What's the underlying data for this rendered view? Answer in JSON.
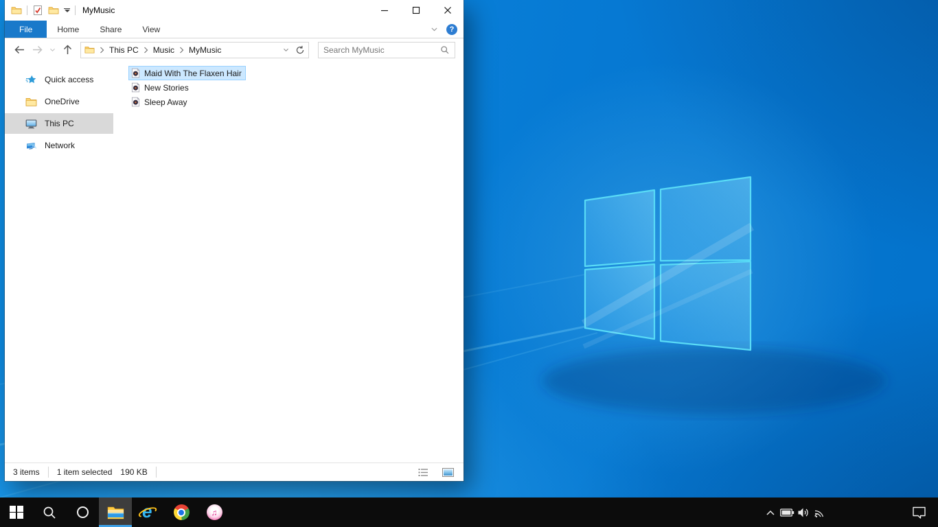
{
  "colors": {
    "accent": "#1979ca",
    "selection_bg": "#cce8ff",
    "selection_border": "#99d1ff",
    "taskbar_bg": "#0c0c0c",
    "active_underline": "#3da1e8"
  },
  "titlebar": {
    "title": "MyMusic",
    "qat_icons": [
      "explorer-folder-icon",
      "properties-check-icon",
      "new-folder-icon",
      "qat-dropdown-icon"
    ],
    "control_icons": [
      "minimize-icon",
      "maximize-icon",
      "close-icon"
    ]
  },
  "ribbon": {
    "tabs": [
      {
        "label": "File",
        "active": true
      },
      {
        "label": "Home",
        "active": false
      },
      {
        "label": "Share",
        "active": false
      },
      {
        "label": "View",
        "active": false
      }
    ],
    "collapse_icon": "chevron-down-icon",
    "help_glyph": "?"
  },
  "navbar": {
    "nav_icons": [
      "back-arrow-icon",
      "forward-arrow-icon",
      "history-chevron-icon",
      "up-arrow-icon"
    ],
    "breadcrumb": {
      "root_icon": "folder-icon",
      "segments": [
        "This PC",
        "Music",
        "MyMusic"
      ]
    },
    "address_icons": [
      "chevron-down-icon",
      "refresh-icon"
    ],
    "search": {
      "placeholder": "Search MyMusic",
      "icon": "search-icon"
    }
  },
  "sidebar": {
    "items": [
      {
        "label": "Quick access",
        "icon": "quick-access-star-icon",
        "selected": false
      },
      {
        "label": "OneDrive",
        "icon": "onedrive-folder-icon",
        "selected": false
      },
      {
        "label": "This PC",
        "icon": "this-pc-icon",
        "selected": true
      },
      {
        "label": "Network",
        "icon": "network-icon",
        "selected": false
      }
    ]
  },
  "files": {
    "items": [
      {
        "name": "Maid With The Flaxen Hair",
        "icon": "music-file-icon",
        "selected": true
      },
      {
        "name": "New Stories",
        "icon": "music-file-icon",
        "selected": false
      },
      {
        "name": "Sleep Away",
        "icon": "music-file-icon",
        "selected": false
      }
    ]
  },
  "statusbar": {
    "count": "3 items",
    "selection": "1 item selected",
    "size": "190 KB",
    "view_buttons": [
      "details-view-icon",
      "thumbnails-view-icon"
    ]
  },
  "taskbar": {
    "buttons": [
      {
        "name": "start",
        "icon": "windows-start-icon",
        "active": false
      },
      {
        "name": "search",
        "icon": "search-icon",
        "active": false
      },
      {
        "name": "cortana",
        "icon": "cortana-icon",
        "active": false
      },
      {
        "name": "file-explorer",
        "icon": "file-explorer-icon",
        "active": true
      },
      {
        "name": "internet-explorer",
        "icon": "internet-explorer-icon",
        "active": false,
        "glyph": "e"
      },
      {
        "name": "chrome",
        "icon": "chrome-icon",
        "active": false
      },
      {
        "name": "itunes",
        "icon": "itunes-icon",
        "active": false,
        "glyph": "♫"
      }
    ],
    "tray_icons": [
      "chevron-up-icon",
      "battery-icon",
      "volume-icon",
      "wifi-icon",
      "action-center-icon"
    ]
  }
}
